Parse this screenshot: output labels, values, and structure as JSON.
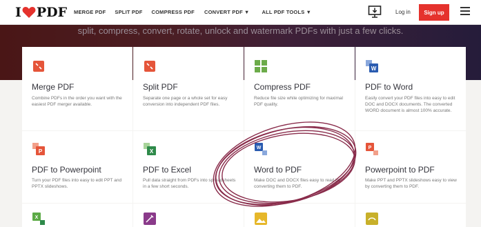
{
  "header": {
    "logo_pre": "I",
    "logo_post": "PDF",
    "nav": [
      {
        "label": "MERGE PDF"
      },
      {
        "label": "SPLIT PDF"
      },
      {
        "label": "COMPRESS PDF"
      },
      {
        "label": "CONVERT PDF",
        "has_caret": true
      },
      {
        "label": "ALL PDF TOOLS",
        "has_caret": true
      }
    ],
    "login": "Log in",
    "signup": "Sign up"
  },
  "hero": {
    "subtitle": "split, compress, convert, rotate, unlock and watermark PDFs with just a few clicks."
  },
  "tools": [
    {
      "title": "Merge PDF",
      "desc": "Combine PDFs in the order you want with the easiest PDF merger available.",
      "icon": "merge-icon",
      "color": "#e5553a"
    },
    {
      "title": "Split PDF",
      "desc": "Separate one page or a whole set for easy conversion into independent PDF files.",
      "icon": "split-icon",
      "color": "#e5553a"
    },
    {
      "title": "Compress PDF",
      "desc": "Reduce file size while optimizing for maximal PDF quality.",
      "icon": "compress-icon",
      "color": "#6cab4a"
    },
    {
      "title": "PDF to Word",
      "desc": "Easily convert your PDF files into easy to edit DOC and DOCX documents. The converted WORD document is almost 100% accurate.",
      "icon": "word-icon",
      "color": "#2a5bb0"
    },
    {
      "title": "PDF to Powerpoint",
      "desc": "Turn your PDF files into easy to edit PPT and PPTX slideshows.",
      "icon": "powerpoint-icon",
      "color": "#e5553a"
    },
    {
      "title": "PDF to Excel",
      "desc": "Pull data straight from PDFs into spreadsheets in a few short seconds.",
      "icon": "excel-icon",
      "color": "#2e8a4a"
    },
    {
      "title": "Word to PDF",
      "desc": "Make DOC and DOCX files easy to read by converting them to PDF.",
      "icon": "word-icon",
      "color": "#2a5bb0"
    },
    {
      "title": "Powerpoint to PDF",
      "desc": "Make PPT and PPTX slideshows easy to view by converting them to PDF.",
      "icon": "powerpoint-icon",
      "color": "#e5553a"
    },
    {
      "title": "",
      "desc": "",
      "icon": "excel-icon",
      "color": "#5caa46"
    },
    {
      "title": "",
      "desc": "",
      "icon": "edit-icon",
      "color": "#8a3a8a"
    },
    {
      "title": "",
      "desc": "",
      "icon": "image-icon",
      "color": "#e6b72a"
    },
    {
      "title": "",
      "desc": "",
      "icon": "image-icon",
      "color": "#c8b02a"
    }
  ]
}
